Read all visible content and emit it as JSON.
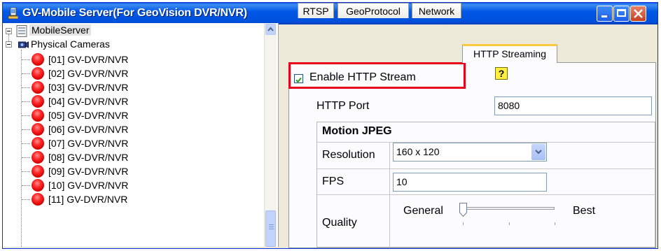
{
  "window": {
    "title": "GV-Mobile Server(For GeoVision DVR/NVR)"
  },
  "tree": {
    "root_label": "MobileServer",
    "group_label": "Physical Cameras",
    "cameras": [
      "[01] GV-DVR/NVR",
      "[02] GV-DVR/NVR",
      "[03] GV-DVR/NVR",
      "[04] GV-DVR/NVR",
      "[05] GV-DVR/NVR",
      "[06] GV-DVR/NVR",
      "[07] GV-DVR/NVR",
      "[08] GV-DVR/NVR",
      "[09] GV-DVR/NVR",
      "[10] GV-DVR/NVR",
      "[11] GV-DVR/NVR"
    ]
  },
  "tabs": [
    {
      "label": "RTSP"
    },
    {
      "label": "GeoProtocol"
    },
    {
      "label": "Network"
    },
    {
      "label": "HTTP Streaming"
    }
  ],
  "active_tab": "HTTP Streaming",
  "http": {
    "enable_label": "Enable HTTP Stream",
    "enable_checked": true,
    "help_glyph": "?",
    "port_label": "HTTP Port",
    "port_value": "8080"
  },
  "mjpeg": {
    "header": "Motion JPEG",
    "resolution_label": "Resolution",
    "resolution_value": "160 x 120",
    "fps_label": "FPS",
    "fps_value": "10",
    "quality_label": "Quality",
    "quality_min_label": "General",
    "quality_max_label": "Best",
    "quality_level": 0
  },
  "colors": {
    "highlight_border": "#e8001a",
    "title_bar": "#0058e5",
    "tab_accent": "#ffc83c"
  }
}
